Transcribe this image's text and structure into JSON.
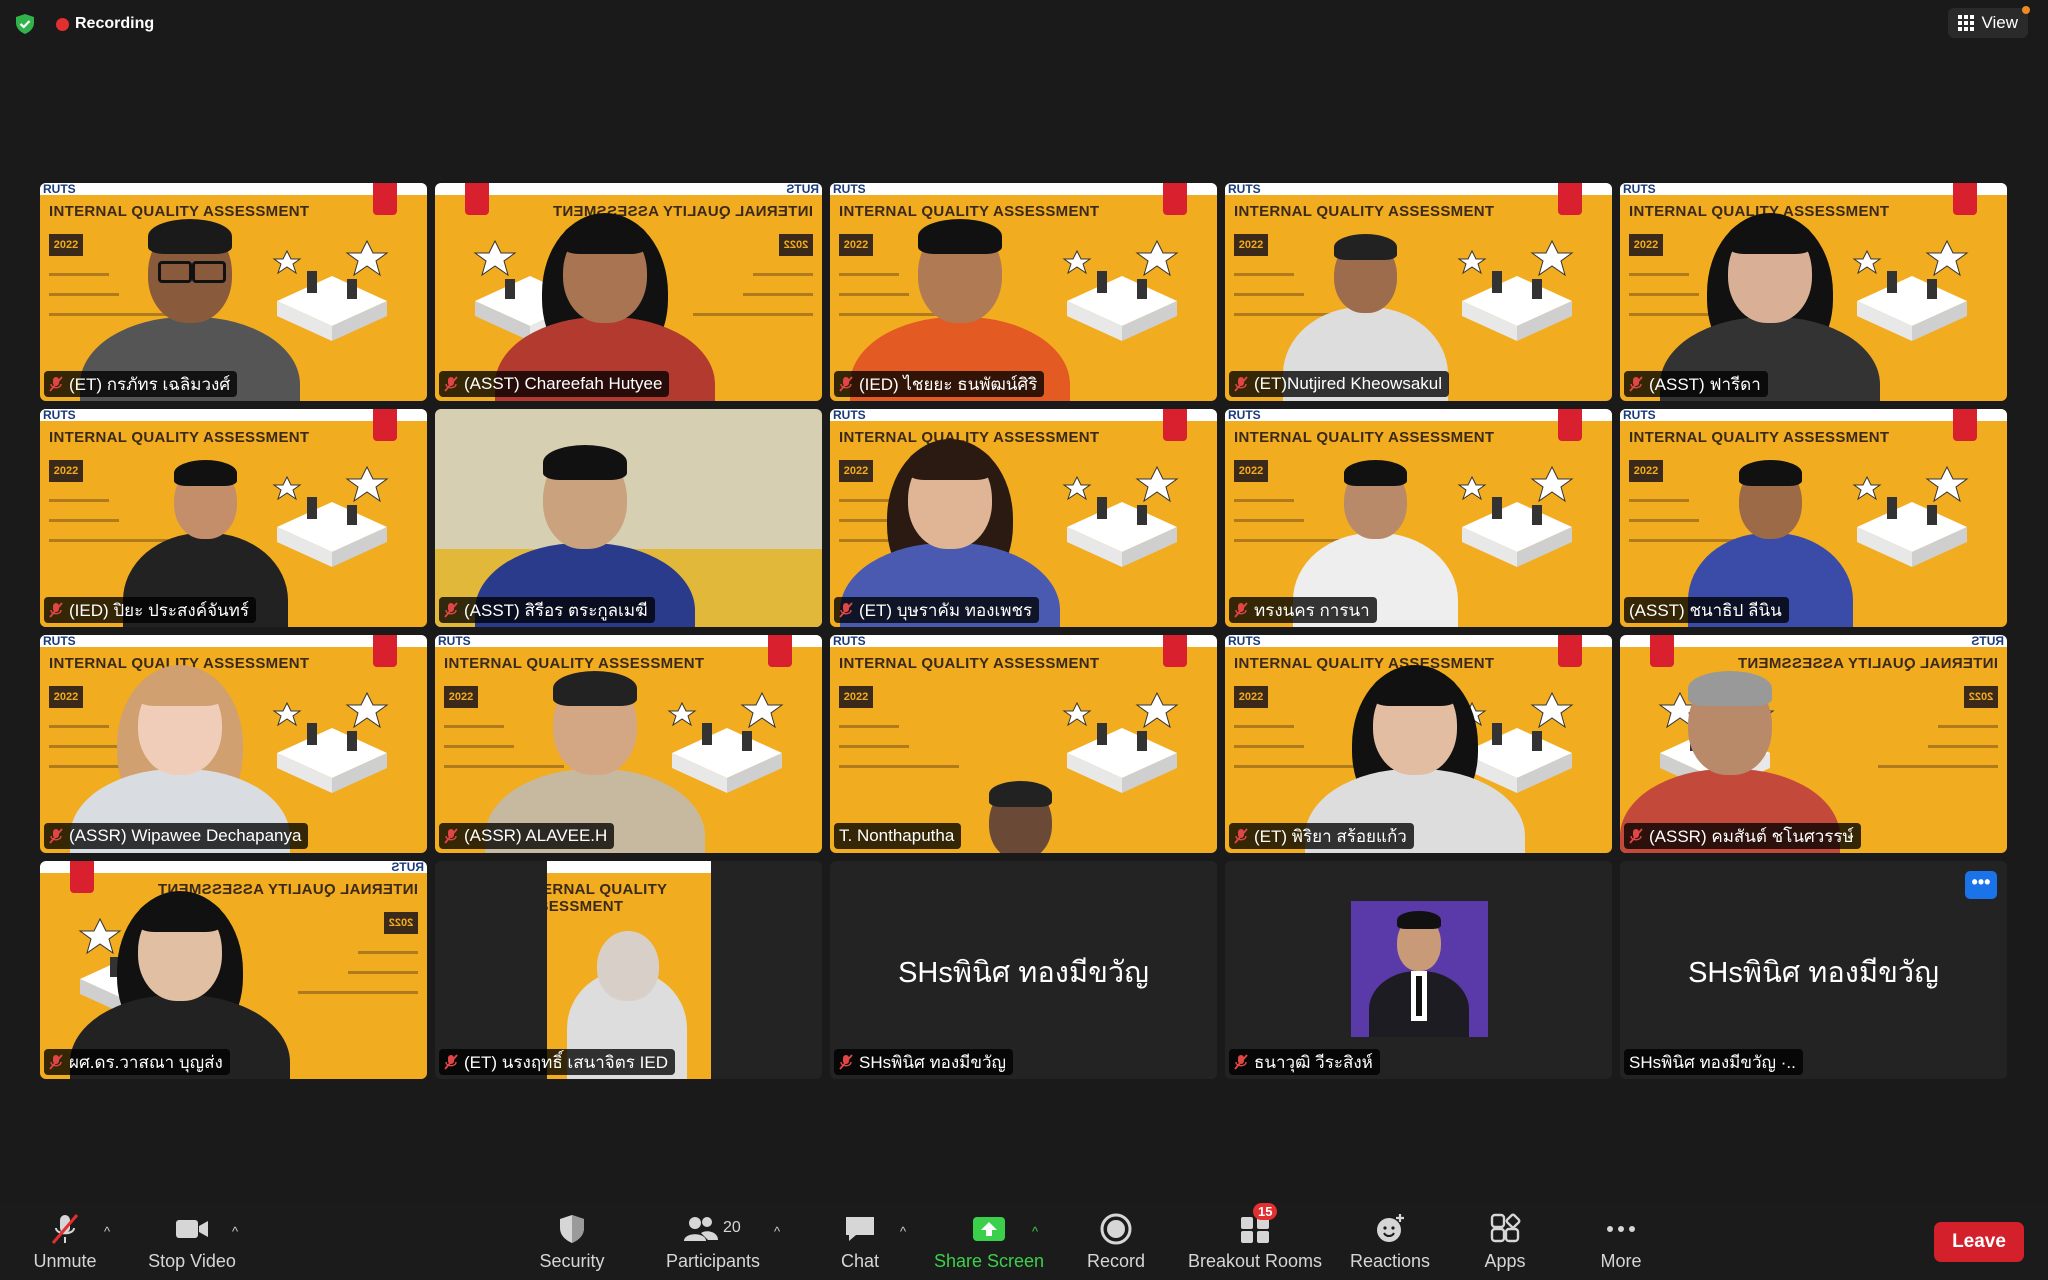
{
  "topbar": {
    "recording_label": "Recording",
    "view_label": "View"
  },
  "colors": {
    "accent_green": "#3bd04b",
    "recording_red": "#e22f2f",
    "leave_red": "#d4202b",
    "slide_yellow": "#f2ac1f"
  },
  "slide": {
    "title": "INTERNAL QUALITY ASSESSMENT",
    "year": "2022",
    "brand": "RUTS"
  },
  "participants": [
    {
      "name": "(ET) กรภัทร เฉลิมวงศ์",
      "muted": true
    },
    {
      "name": "(ASST) Chareefah Hutyee",
      "muted": true
    },
    {
      "name": "(IED) ไชยยะ ธนพัฒน์ศิริ",
      "muted": true
    },
    {
      "name": "(ET)Nutjired Kheowsakul",
      "muted": true
    },
    {
      "name": "(ASST) ฟารีดา",
      "muted": true
    },
    {
      "name": "(IED) ปิยะ ประสงค์จันทร์",
      "muted": true
    },
    {
      "name": "(ASST) สิรีอร ตระกูลเมฆี",
      "muted": true
    },
    {
      "name": "(ET) บุษราคัม ทองเพชร",
      "muted": true
    },
    {
      "name": "ทรงนคร การนา",
      "muted": true
    },
    {
      "name": "(ASST) ชนาธิป ลีนิน",
      "muted": false
    },
    {
      "name": "(ASSR) Wipawee Dechapanya",
      "muted": true
    },
    {
      "name": "(ASSR) ALAVEE.H",
      "muted": true
    },
    {
      "name": "T. Nonthaputha",
      "muted": false
    },
    {
      "name": "(ET) พิริยา สร้อยแก้ว",
      "muted": true
    },
    {
      "name": "(ASSR) คมสันต์ ชโนศวรรษ์",
      "muted": true
    },
    {
      "name": "ผศ.ดร.วาสณา บุญส่ง",
      "muted": true
    },
    {
      "name": "(ET) นรงฤทธิ์ เสนาจิตร IED",
      "muted": true
    },
    {
      "name": "SHsพินิศ ทองมีขวัญ",
      "muted": true,
      "display": "SHsพินิศ ทองมีขวัญ"
    },
    {
      "name": "ธนาวุฒิ วีระสิงห์",
      "muted": true
    },
    {
      "name": "SHsพินิศ ทองมีขวัญ ·..",
      "muted": false,
      "display": "SHsพินิศ ทองมีขวัญ",
      "more": "•••"
    }
  ],
  "toolbar": {
    "unmute": "Unmute",
    "stop_video": "Stop Video",
    "security": "Security",
    "participants": "Participants",
    "participants_count": "20",
    "chat": "Chat",
    "share_screen": "Share Screen",
    "record": "Record",
    "breakout_rooms": "Breakout Rooms",
    "breakout_badge": "15",
    "reactions": "Reactions",
    "apps": "Apps",
    "more": "More",
    "leave": "Leave"
  }
}
